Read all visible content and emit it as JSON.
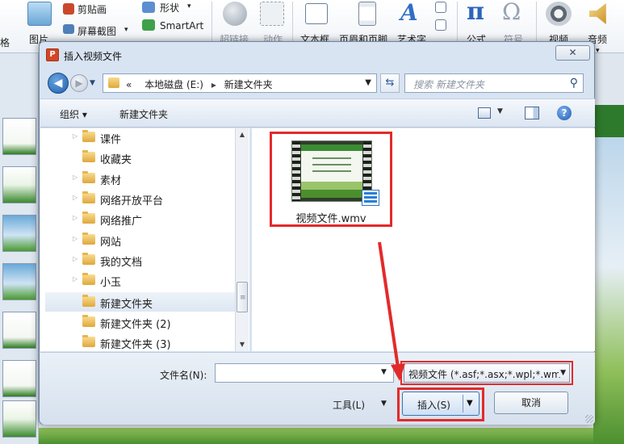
{
  "ribbon": {
    "cut_left": "格",
    "picture": "图片",
    "clipboard": "剪贴画",
    "screenshot": "屏幕截图",
    "shapes": "形状",
    "smartart": "SmartArt",
    "hyperlink": "超链接",
    "action": "动作",
    "textbox": "文本框",
    "header_footer": "页眉和页脚",
    "wordart": "艺术字",
    "equation": "公式",
    "symbol": "符号",
    "video": "视频",
    "audio": "音频",
    "group_left": "格"
  },
  "dialog": {
    "title": "插入视频文件",
    "close_glyph": "✕",
    "app_icon_letter": "P"
  },
  "address": {
    "path_prefix": "«",
    "drive": "本地磁盘 (E:)",
    "folder": "新建文件夹",
    "arrow_sep": "▸",
    "search_placeholder": "搜索 新建文件夹"
  },
  "toolbar": {
    "organize": "组织 ▾",
    "new_folder": "新建文件夹"
  },
  "tree": [
    {
      "label": "课件"
    },
    {
      "label": "收藏夹"
    },
    {
      "label": "素材"
    },
    {
      "label": "网络开放平台"
    },
    {
      "label": "网络推广"
    },
    {
      "label": "网站"
    },
    {
      "label": "我的文档"
    },
    {
      "label": "小玉"
    },
    {
      "label": "新建文件夹"
    },
    {
      "label": "新建文件夹 (2)"
    },
    {
      "label": "新建文件夹 (3)"
    }
  ],
  "file": {
    "name": "视频文件.wmv"
  },
  "bottom": {
    "filename_label": "文件名(N):",
    "filename_value": "",
    "filter": "视频文件 (*.asf;*.asx;*.wpl;*.wm",
    "tools": "工具(L)",
    "insert": "插入(S)",
    "cancel": "取消"
  },
  "colors": {
    "highlight": "#e32a2a",
    "folder": "#e0a93a",
    "dialog_bg": "#d8e4f2"
  }
}
